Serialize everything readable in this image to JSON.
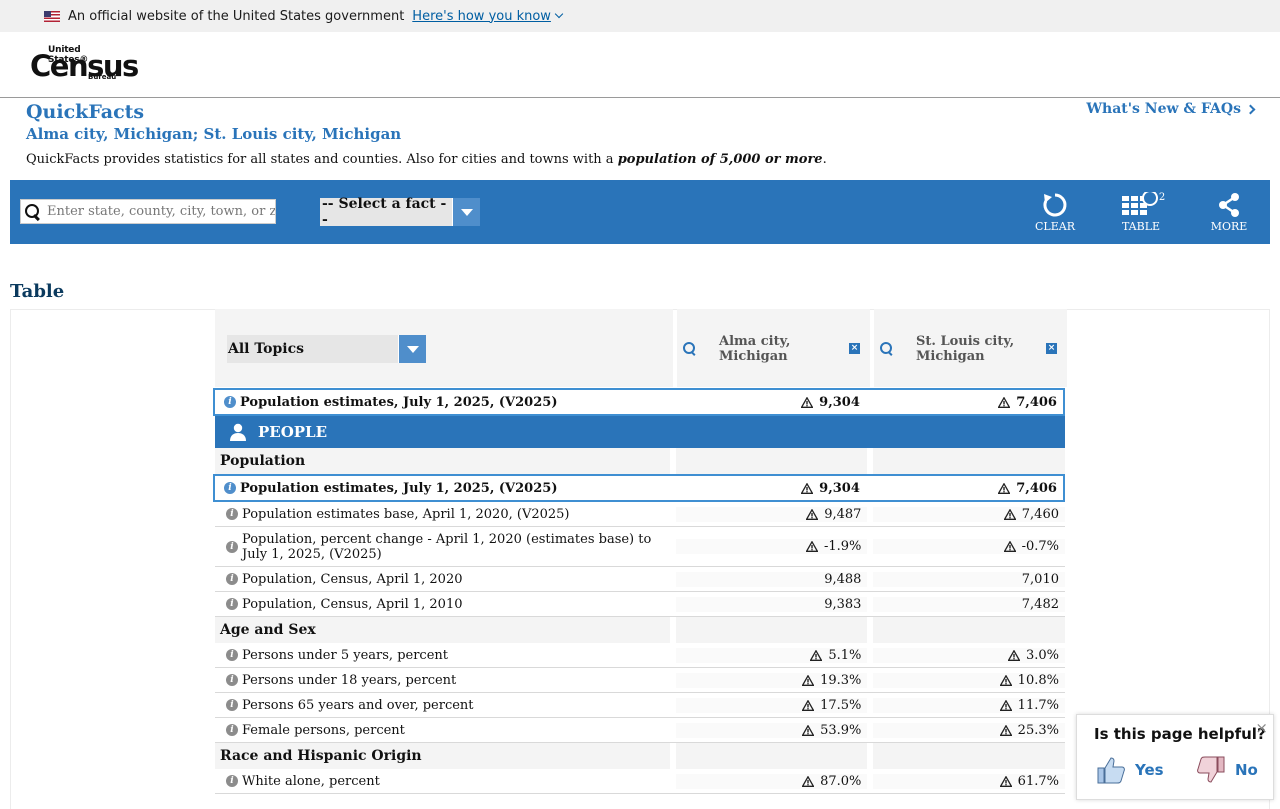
{
  "gov_banner": {
    "text": "An official website of the United States government",
    "link": "Here's how you know"
  },
  "logo": {
    "top": "United States®",
    "main": "Census",
    "bottom": "Bureau"
  },
  "page": {
    "title": "QuickFacts",
    "subtitle": "Alma city, Michigan; St. Louis city, Michigan",
    "desc_prefix": "QuickFacts provides statistics for all states and counties. Also for cities and towns with a ",
    "desc_bold": "population of 5,000 or more",
    "desc_suffix": ".",
    "whats_new": "What's New & FAQs"
  },
  "toolbar": {
    "search_placeholder": "Enter state, county, city, town, or zip code",
    "select_fact": "-- Select a fact --",
    "clear": "CLEAR",
    "table": "TABLE",
    "table_badge": "2",
    "more": "MORE"
  },
  "section_heading": "Table",
  "table": {
    "topic_select": "All Topics",
    "locations": [
      "Alma city, Michigan",
      "St. Louis city, Michigan"
    ],
    "rows": [
      {
        "type": "highlight",
        "label": "Population estimates, July 1, 2025, (V2025)",
        "v1": "9,304",
        "v2": "7,406",
        "warn": true
      },
      {
        "type": "people",
        "label": "PEOPLE"
      },
      {
        "type": "section",
        "label": "Population"
      },
      {
        "type": "highlight",
        "label": "Population estimates, July 1, 2025, (V2025)",
        "v1": "9,304",
        "v2": "7,406",
        "warn": true
      },
      {
        "type": "data",
        "label": "Population estimates base, April 1, 2020, (V2025)",
        "v1": "9,487",
        "v2": "7,460",
        "warn": true
      },
      {
        "type": "data",
        "label": "Population, percent change - April 1, 2020 (estimates base) to July 1, 2025, (V2025)",
        "v1": "-1.9%",
        "v2": "-0.7%",
        "warn": true
      },
      {
        "type": "data",
        "label": "Population, Census, April 1, 2020",
        "v1": "9,488",
        "v2": "7,010",
        "warn": false
      },
      {
        "type": "data",
        "label": "Population, Census, April 1, 2010",
        "v1": "9,383",
        "v2": "7,482",
        "warn": false
      },
      {
        "type": "section",
        "label": "Age and Sex"
      },
      {
        "type": "data",
        "label": "Persons under 5 years, percent",
        "v1": "5.1%",
        "v2": "3.0%",
        "warn": true
      },
      {
        "type": "data",
        "label": "Persons under 18 years, percent",
        "v1": "19.3%",
        "v2": "10.8%",
        "warn": true
      },
      {
        "type": "data",
        "label": "Persons 65 years and over, percent",
        "v1": "17.5%",
        "v2": "11.7%",
        "warn": true
      },
      {
        "type": "data",
        "label": "Female persons, percent",
        "v1": "53.9%",
        "v2": "25.3%",
        "warn": true
      },
      {
        "type": "section",
        "label": "Race and Hispanic Origin"
      },
      {
        "type": "data",
        "label": "White alone, percent",
        "v1": "87.0%",
        "v2": "61.7%",
        "warn": true
      }
    ]
  },
  "feedback": {
    "title": "Is this page helpful?",
    "yes": "Yes",
    "no": "No",
    "close": "×"
  }
}
